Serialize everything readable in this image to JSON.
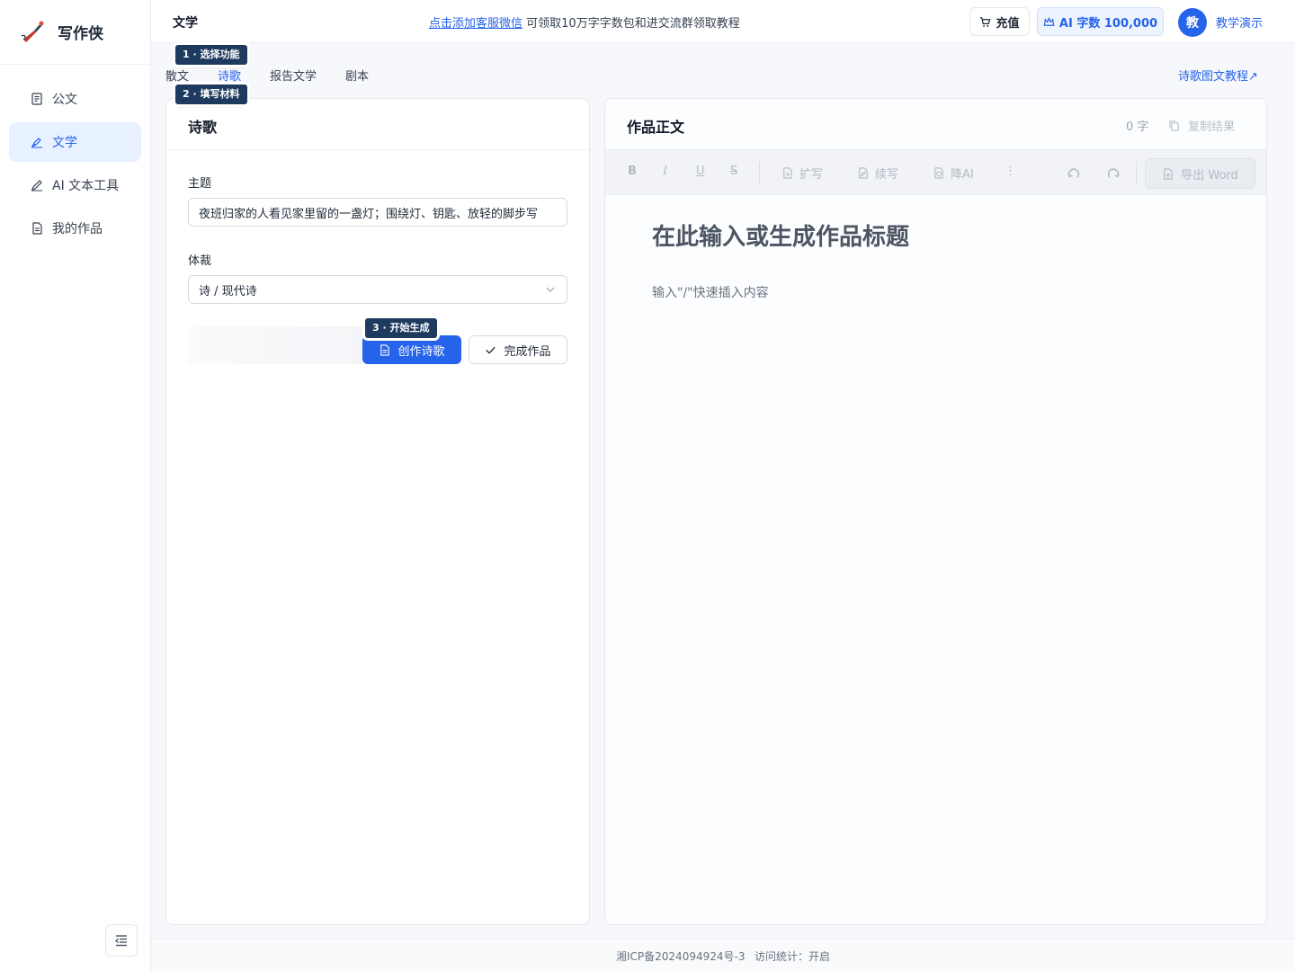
{
  "brand": {
    "name": "写作侠"
  },
  "sidebar": {
    "items": [
      {
        "label": "公文",
        "icon": "document-list-icon"
      },
      {
        "label": "文学",
        "icon": "pen-nib-icon"
      },
      {
        "label": "AI 文本工具",
        "icon": "pencil-icon"
      },
      {
        "label": "我的作品",
        "icon": "file-icon"
      }
    ],
    "active_index": 1
  },
  "header": {
    "title": "文学",
    "notice_link": "点击添加客服微信",
    "notice_text": "可领取10万字字数包和进交流群领取教程",
    "recharge_label": "充值",
    "quota_label": "AI 字数 100,000",
    "avatar_char": "教",
    "username": "教学演示"
  },
  "tabs": [
    "散文",
    "诗歌",
    "报告文学",
    "剧本"
  ],
  "active_tab": 1,
  "tutorial_link": "诗歌图文教程↗",
  "steps": {
    "s1": "1 · 选择功能",
    "s2": "2 · 填写材料",
    "s3": "3 · 开始生成"
  },
  "form": {
    "panel_title": "诗歌",
    "topic_label": "主题",
    "topic_value": "夜班归家的人看见家里留的一盏灯；围绕灯、钥匙、放轻的脚步写",
    "genre_label": "体裁",
    "genre_value": "诗 / 现代诗",
    "create_label": "创作诗歌",
    "finish_label": "完成作品"
  },
  "editor": {
    "title": "作品正文",
    "word_count": "0 字",
    "copy_label": "复制结果",
    "toolbar": {
      "bold": "B",
      "italic": "I",
      "underline": "U",
      "strike": "S",
      "expand": "扩写",
      "continue": "续写",
      "reduce_ai": "降AI",
      "more": "⋮",
      "export": "导出 Word"
    },
    "doc_title_placeholder": "在此输入或生成作品标题",
    "doc_body_hint": "输入\"/\"快速插入内容"
  },
  "footer": {
    "icp": "湘ICP备2024094924号-3",
    "stats": "访问统计：开启"
  },
  "colors": {
    "accent": "#2563eb",
    "step_badge": "#1e3a5f",
    "active_nav_bg": "#e8f1ff"
  }
}
